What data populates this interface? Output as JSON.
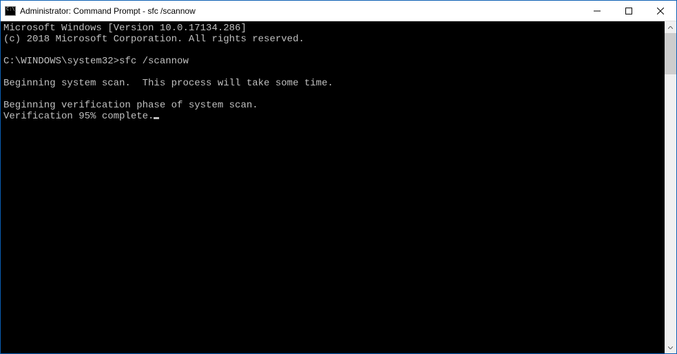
{
  "window": {
    "title": "Administrator: Command Prompt - sfc  /scannow"
  },
  "terminal": {
    "lines": [
      "Microsoft Windows [Version 10.0.17134.286]",
      "(c) 2018 Microsoft Corporation. All rights reserved.",
      "",
      "C:\\WINDOWS\\system32>sfc /scannow",
      "",
      "Beginning system scan.  This process will take some time.",
      "",
      "Beginning verification phase of system scan.",
      "Verification 95% complete."
    ],
    "cursor_after_last": true
  }
}
